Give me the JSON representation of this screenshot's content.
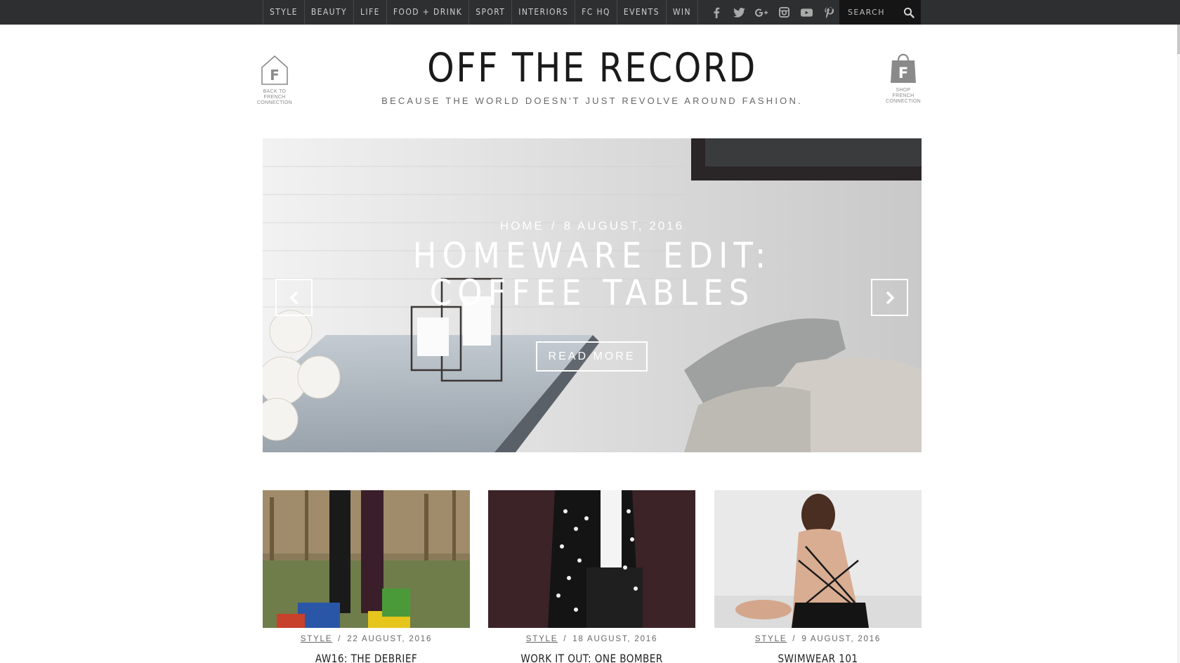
{
  "nav": {
    "items": [
      "STYLE",
      "BEAUTY",
      "LIFE",
      "FOOD + DRINK",
      "SPORT",
      "INTERIORS",
      "FC HQ",
      "EVENTS",
      "WIN"
    ],
    "social": [
      "facebook-icon",
      "twitter-icon",
      "google-plus-icon",
      "instagram-icon",
      "youtube-icon",
      "pinterest-icon"
    ],
    "search_placeholder": "SEARCH"
  },
  "header": {
    "title": "OFF THE RECORD",
    "tagline": "BECAUSE THE WORLD DOESN'T JUST REVOLVE AROUND FASHION.",
    "back_link": {
      "letter": "F",
      "lines": [
        "BACK TO",
        "FRENCH",
        "CONNECTION"
      ]
    },
    "shop_link": {
      "letter": "F",
      "lines": [
        "SHOP",
        "FRENCH",
        "CONNECTION"
      ]
    }
  },
  "hero": {
    "category": "HOME",
    "separator": "/",
    "date": "8 AUGUST, 2016",
    "title": "HOMEWARE EDIT: COFFEE TABLES",
    "button_label": "READ MORE"
  },
  "cards": [
    {
      "category": "STYLE",
      "date": "22 AUGUST, 2016",
      "title": "AW16: THE DEBRIEF"
    },
    {
      "category": "STYLE",
      "date": "18 AUGUST, 2016",
      "title": "WORK IT OUT: ONE BOMBER WORN TWO"
    },
    {
      "category": "STYLE",
      "date": "9 AUGUST, 2016",
      "title": "SWIMWEAR 101"
    }
  ],
  "colors": {
    "topbar": "#2e2f30",
    "search_bg": "#151515",
    "nav_text": "#cfcfcf"
  }
}
